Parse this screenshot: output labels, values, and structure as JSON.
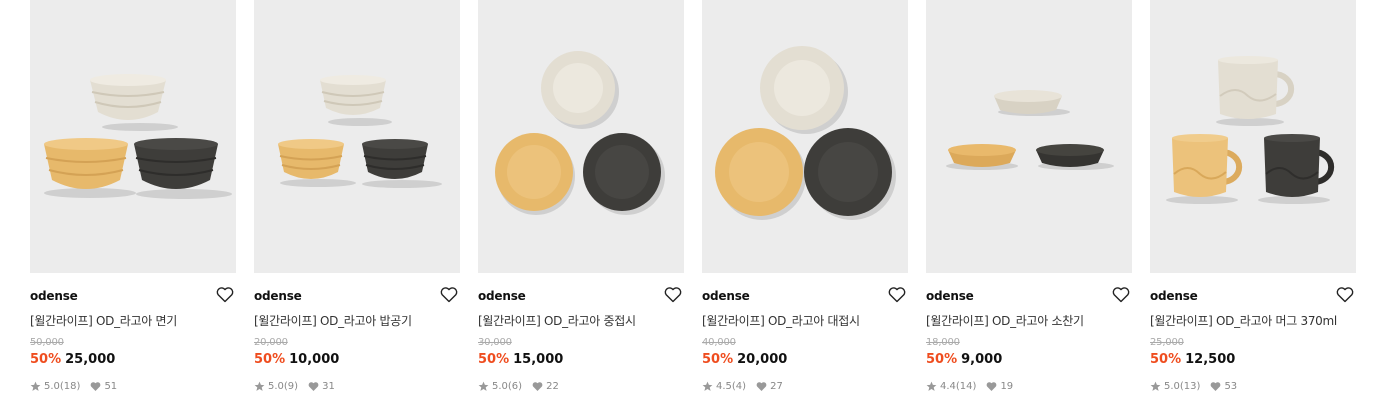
{
  "colors": {
    "discount": "#ef4d1f",
    "thumb_bg": "#ececec",
    "cream": "#e2ddd1",
    "mustard": "#e6b86b",
    "charcoal": "#3d3c39"
  },
  "products": [
    {
      "brand": "odense",
      "name": "[윌간라이프] OD_라고아 면기",
      "original_price": "50,000",
      "discount": "50%",
      "price": "25,000",
      "rating": "5.0",
      "reviews": "(18)",
      "likes": "51",
      "image_icon": "bowl-set-image"
    },
    {
      "brand": "odense",
      "name": "[윌간라이프] OD_라고아 밥공기",
      "original_price": "20,000",
      "discount": "50%",
      "price": "10,000",
      "rating": "5.0",
      "reviews": "(9)",
      "likes": "31",
      "image_icon": "rice-bowl-set-image"
    },
    {
      "brand": "odense",
      "name": "[윌간라이프] OD_라고아 중접시",
      "original_price": "30,000",
      "discount": "50%",
      "price": "15,000",
      "rating": "5.0",
      "reviews": "(6)",
      "likes": "22",
      "image_icon": "medium-plate-set-image"
    },
    {
      "brand": "odense",
      "name": "[윌간라이프] OD_라고아 대접시",
      "original_price": "40,000",
      "discount": "50%",
      "price": "20,000",
      "rating": "4.5",
      "reviews": "(4)",
      "likes": "27",
      "image_icon": "large-plate-set-image"
    },
    {
      "brand": "odense",
      "name": "[윌간라이프] OD_라고아 소찬기",
      "original_price": "18,000",
      "discount": "50%",
      "price": "9,000",
      "rating": "4.4",
      "reviews": "(14)",
      "likes": "19",
      "image_icon": "side-dish-set-image"
    },
    {
      "brand": "odense",
      "name": "[윌간라이프] OD_라고아 머그 370ml",
      "original_price": "25,000",
      "discount": "50%",
      "price": "12,500",
      "rating": "5.0",
      "reviews": "(13)",
      "likes": "53",
      "image_icon": "mug-set-image"
    }
  ]
}
